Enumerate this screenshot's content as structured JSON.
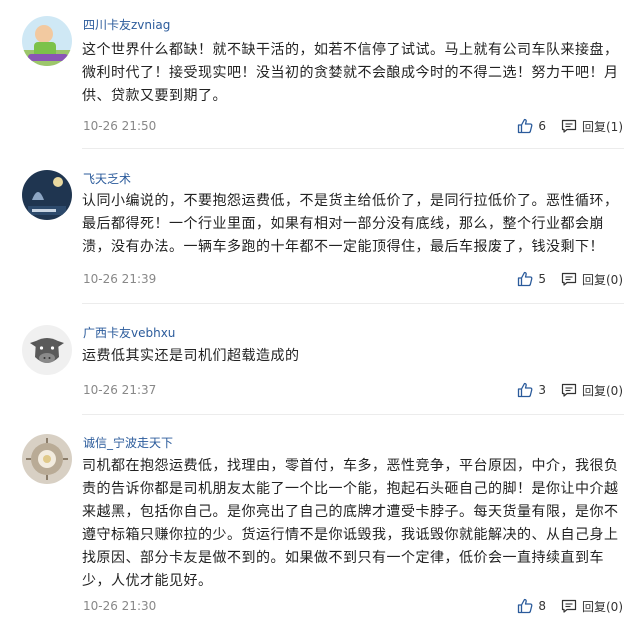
{
  "comments": [
    {
      "username": "四川卡友zvniag",
      "text": "这个世界什么都缺！就不缺干活的，如若不信停了试试。马上就有公司车队来接盘，微利时代了！接受现实吧！没当初的贪婪就不会酿成今时的不得二选！努力干吧！月供、贷款又要到期了。",
      "time": "10-26 21:50",
      "likes": "6",
      "reply": "回复(1)",
      "avatar_icon": "user-avatar-photo"
    },
    {
      "username": "飞天乏术",
      "text": "认同小编说的，不要抱怨运费低，不是货主给低价了，是同行拉低价了。恶性循环，最后都得死！一个行业里面，如果有相对一部分没有底线，那么，整个行业都会崩溃，没有办法。一辆车多跑的十年都不一定能顶得住，最后车报废了，钱没剩下！",
      "time": "10-26 21:39",
      "likes": "5",
      "reply": "回复(0)",
      "avatar_icon": "user-avatar-photo"
    },
    {
      "username": "广西卡友vebhxu",
      "text": "运费低其实还是司机们超载造成的",
      "time": "10-26 21:37",
      "likes": "3",
      "reply": "回复(0)",
      "avatar_icon": "default-cow-avatar"
    },
    {
      "username": "诚信_宁波走天下",
      "text": "司机都在抱怨运费低，找理由，零首付，车多，恶性竞争，平台原因，中介，我很负责的告诉你都是司机朋友太能了一个比一个能，抱起石头砸自己的脚！是你让中介越来越黑，包括你自己。是你亮出了自己的底牌才遭受卡脖子。每天货量有限，是你不遵守标箱只赚你拉的少。货运行情不是你诋毁我，我诋毁你就能解决的、从自己身上找原因、部分卡友是做不到的。如果做不到只有一个定律，低价会一直持续直到车少，人优才能见好。",
      "time": "10-26 21:30",
      "likes": "8",
      "reply": "回复(0)",
      "avatar_icon": "user-avatar-photo"
    }
  ],
  "colors": {
    "username": "#2b5b9b",
    "timestamp": "#888888",
    "text": "#222222"
  }
}
